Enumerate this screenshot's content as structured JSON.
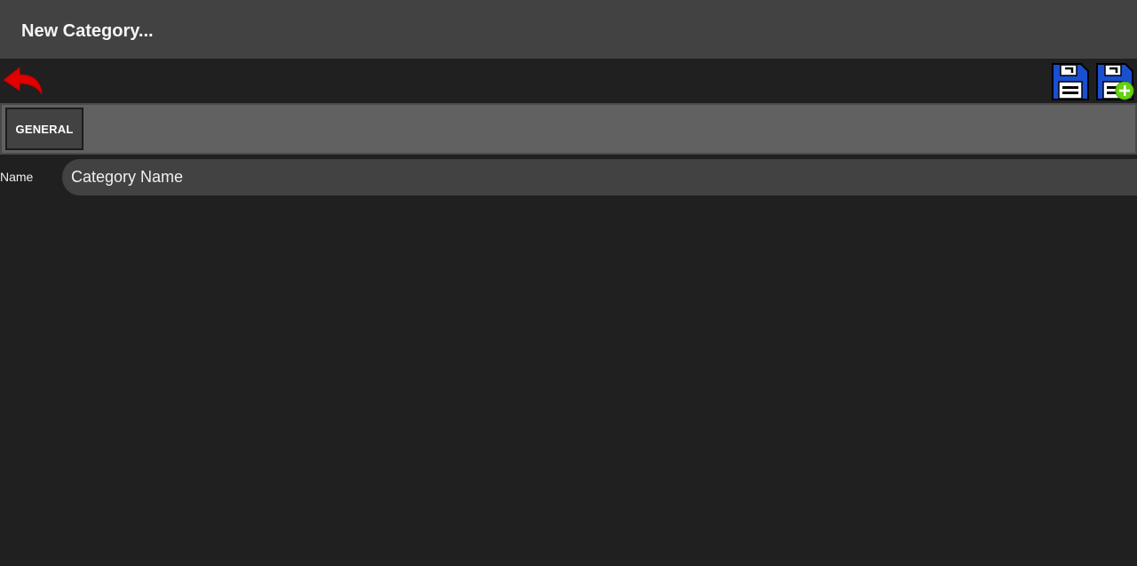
{
  "window": {
    "title": "New Category..."
  },
  "toolbar": {
    "back_icon": "back-arrow-icon",
    "save_icon": "floppy-save-icon",
    "save_new_icon": "floppy-save-add-icon",
    "colors": {
      "back_arrow": "#e00000",
      "floppy_body": "#1a4fd0",
      "add_badge": "#66d011"
    }
  },
  "tabs": [
    {
      "label": "GENERAL",
      "selected": true
    }
  ],
  "form": {
    "name_label": "Name",
    "name_placeholder": "Category Name",
    "name_value": ""
  }
}
